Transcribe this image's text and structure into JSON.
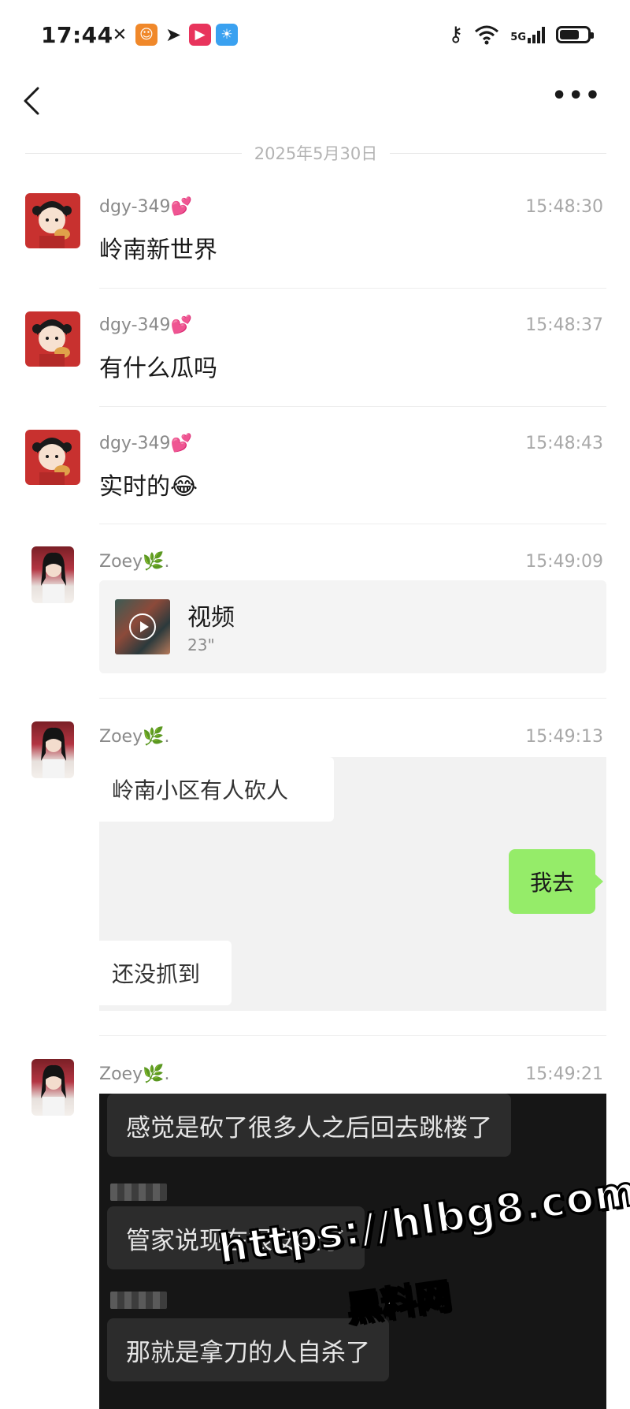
{
  "status_bar": {
    "time": "17:44",
    "network": "5G",
    "app_icons": [
      {
        "name": "missed-call-icon",
        "color": "#1a1a1a"
      },
      {
        "name": "app-shield-icon",
        "color": "#f0882a"
      },
      {
        "name": "telegram-icon",
        "color": "#1a1a1a"
      },
      {
        "name": "video-app-icon",
        "color": "#e8345c"
      },
      {
        "name": "weather-app-icon",
        "color": "#3aa1f0"
      }
    ]
  },
  "header": {
    "more_label": "•••"
  },
  "date_divider": "2025年5月30日",
  "messages": [
    {
      "sender": "dgy-349💕",
      "time": "15:48:30",
      "text": "岭南新世界"
    },
    {
      "sender": "dgy-349💕",
      "time": "15:48:37",
      "text": "有什么瓜吗"
    },
    {
      "sender": "dgy-349💕",
      "time": "15:48:43",
      "text": "实时的😂"
    },
    {
      "sender": "Zoey🌿.",
      "time": "15:49:09",
      "video": {
        "label": "视频",
        "duration": "23\""
      }
    },
    {
      "sender": "Zoey🌿.",
      "time": "15:49:13",
      "screenshot": {
        "bubble1": "岭南小区有人砍人",
        "green_bubble": "我去",
        "bubble2": "还没抓到"
      }
    },
    {
      "sender": "Zoey🌿.",
      "time": "15:49:21",
      "dark_screenshot": {
        "line1": "感觉是砍了很多人之后回去跳楼了",
        "line2": "管家说现在很安全了",
        "line3": "那就是拿刀的人自杀了"
      }
    }
  ],
  "watermark": {
    "url": "https://hlbg8.com",
    "cn": "黑料网"
  }
}
